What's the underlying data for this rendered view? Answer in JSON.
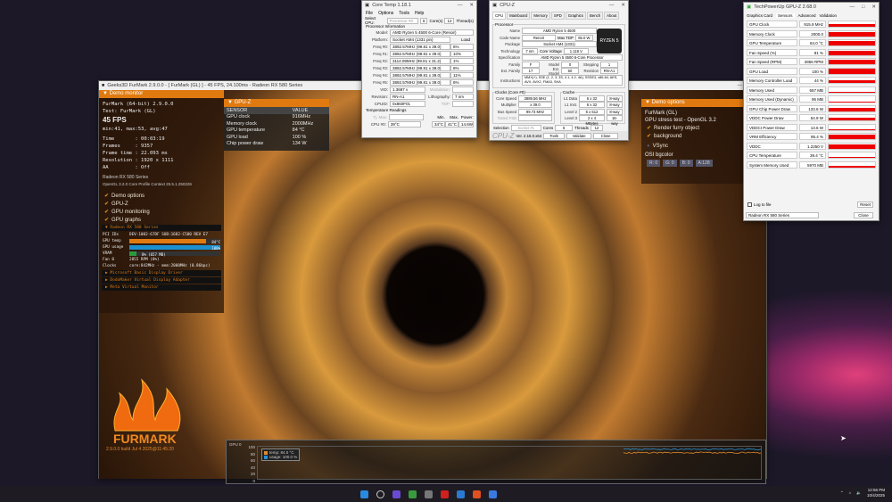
{
  "furmark": {
    "title": "Geeks3D FurMark 2.9.0.0 - [ FurMark (GL) ] - 45 FPS, 24.100ms - Radeon RX 580 Series",
    "demo_monitor": {
      "header": "Demo monitor",
      "name": "FurMark (64-bit) 2.9.0.0",
      "test": "Test: FurMark (GL)",
      "fps": "45 FPS",
      "stats": "min:41, max:53, avg:47",
      "lines": [
        "Time       : 00:03:19",
        "Frames     : 9357",
        "Frame time : 22.093 ms",
        "Resolution : 1920 x 1111",
        "AA         : Off"
      ],
      "gpu": "Radeon RX 580 Series",
      "opengl": "OpenGL 3.2.0 Core Profile Context 25.5.1.250226",
      "checks": [
        "Demo options",
        "GPU-Z",
        "GPU monitoring",
        "GPU graphs"
      ],
      "gpu_group": "Radeon RX 580 Series",
      "pci": "PCI IDs",
      "pci_val": "DEV:1002-67DF SUB:1682-C580 REV E7",
      "temp_label": "GPU temp",
      "temp_val": "84°C",
      "temp_pct": 84,
      "usage_label": "GPU usage",
      "usage_val": "100%",
      "usage_pct": 100,
      "vram_label": "VRAM",
      "vram_val": "8% (657 MB)",
      "vram_pct": 8,
      "fan_label": "Fan 0",
      "fan_val": "2855 RPM (0%)",
      "clocks_label": "Clocks",
      "clocks_val": "core:842MHz - mem:2000MHz (0.86bpc)",
      "adapters": [
        "Microsoft Basic Display Driver",
        "DodoMaker Virtual Display Adapter",
        "Meta Virtual Monitor"
      ]
    },
    "gpuz_panel": {
      "header": "GPU-Z",
      "cols": [
        "SENSOR",
        "VALUE"
      ],
      "rows": [
        [
          "GPU clock",
          "916MHz"
        ],
        [
          "Memory clock",
          "2000MHz"
        ],
        [
          "GPU temperature",
          "84 °C"
        ],
        [
          "GPU load",
          "100 %"
        ],
        [
          "Chip power draw",
          "134 W"
        ]
      ]
    },
    "demo_options": {
      "header": "Demo options",
      "name": "FurMark (GL)",
      "desc": "GPU stress test - OpenGL 3.2",
      "checks": [
        "Render furry object",
        "background"
      ],
      "vsync": "VSync",
      "osi_label": "OSI bgcolor",
      "osi": [
        "R: 0",
        "G: 0",
        "B: 0",
        "A:128"
      ]
    },
    "logo_version": "2.9.0.0 build Jul  4 2025@11:45:20",
    "graph": {
      "title": "GPU 0",
      "ticks": [
        "100",
        "80",
        "60",
        "40",
        "20",
        "0"
      ],
      "legend": [
        "temp: 84.0 °C",
        "usage: 100.0 %"
      ],
      "colors": [
        "#e08a30",
        "#2a90d0"
      ]
    }
  },
  "coretemp": {
    "title": "Core Temp 1.18.1",
    "menu": [
      "File",
      "Options",
      "Tools",
      "Help"
    ],
    "select_cpu": "Select CPU:",
    "cpu": "Processor #0",
    "cores": "6",
    "cores_l": "Core(s)",
    "threads": "12",
    "threads_l": "Thread(s)",
    "section": "Processor Information",
    "model_l": "Model:",
    "model": "AMD Ryzen 5 4500 6-Core (Renoir)",
    "platform_l": "Platform:",
    "platform": "Socket AM4 (1331 pin)",
    "load_l": "Load",
    "freqs": [
      [
        "Freq #0:",
        "3892.57MHz (99.81 x 39.0)",
        "6%"
      ],
      [
        "Freq #1:",
        "3892.57MHz (99.81 x 39.0)",
        "10%"
      ],
      [
        "Freq #2:",
        "3114.09MHz (99.81 x 31.2)",
        "1%"
      ],
      [
        "Freq #3:",
        "3892.57MHz (99.81 x 39.0)",
        "8%"
      ],
      [
        "Freq #4:",
        "3892.57MHz (99.81 x 39.0)",
        "11%"
      ],
      [
        "Freq #5:",
        "3892.57MHz (99.81 x 39.0)",
        "6%"
      ]
    ],
    "vid_l": "VID:",
    "vid": "1.3687 v",
    "modulation_l": "Modulation:",
    "revision_l": "Revision:",
    "revision": "RN-A1",
    "litho_l": "Lithography:",
    "litho": "7 nm",
    "cpuid_l": "CPUID:",
    "cpuid": "0x860F01",
    "tdp_l": "TDP:",
    "temp_section": "Temperature Readings",
    "tjmax_l": "Tj. Max:",
    "min_l": "Min.",
    "max_l": "Max.",
    "power_l": "Power:",
    "cpu0_l": "CPU #0:",
    "cpu0": "39°C",
    "min": "34°C",
    "max": "41°C",
    "power": "14.6W"
  },
  "cpuz": {
    "title": "CPU-Z",
    "tabs": [
      "CPU",
      "Mainboard",
      "Memory",
      "SPD",
      "Graphics",
      "Bench",
      "About"
    ],
    "processor": "Processor",
    "name_l": "Name",
    "name": "AMD Ryzen 5 4500",
    "code_l": "Code Name",
    "code": "Renoir",
    "tdp_l": "Max TDP",
    "tdp": "65.0 W",
    "pkg_l": "Package",
    "pkg": "Socket AM4 (1331)",
    "tech_l": "Technology",
    "tech": "7 nm",
    "volt_l": "Core Voltage",
    "volt": "1.118 V",
    "spec_l": "Specification",
    "spec": "AMD Ryzen 5 4500 6-Core Processor",
    "family_l": "Family",
    "family": "F",
    "model_l": "Model",
    "model": "0",
    "step_l": "Stepping",
    "step": "1",
    "extfam_l": "Ext. Family",
    "extfam": "17",
    "extmod_l": "Ext. Model",
    "extmod": "60",
    "rev_l": "Revision",
    "rev": "RN-A1",
    "instr_l": "Instructions",
    "instr": "MMX(+), SSE (1, 2, 3, 3S, 4.1, 4.2, 4A), SSSE3, x86-64, AES, AVX, AVX2, FMA3, SHA",
    "clocks": "Clocks (Core #0)",
    "speed_l": "Core Speed",
    "speed": "3889.56 MHz",
    "mult_l": "Multiplier",
    "mult": "x 39.0",
    "bus_l": "Bus Speed",
    "bus": "99.73 MHz",
    "fsb_l": "Rated FSB",
    "cache": "Cache",
    "caches": [
      [
        "L1 Data",
        "6 x 32 KBytes",
        "8-way"
      ],
      [
        "L1 Inst.",
        "6 x 32 KBytes",
        "8-way"
      ],
      [
        "Level 2",
        "6 x 512 KBytes",
        "8-way"
      ],
      [
        "Level 3",
        "2 x 4 MBytes",
        "16-way"
      ]
    ],
    "sel_l": "Selection",
    "sel": "Socket #1",
    "cores_l": "Cores",
    "cores": "6",
    "threads_l": "Threads",
    "threads": "12",
    "brand": "CPU-Z",
    "ver": "Ver. 2.16.0.x64",
    "tools": "Tools",
    "validate": "Validate",
    "close": "Close",
    "logo": "RYZEN 5"
  },
  "gpuz": {
    "title": "TechPowerUp GPU-Z 2.68.0",
    "tabs": [
      "Graphics Card",
      "Sensors",
      "Advanced",
      "Validation"
    ],
    "sensors": [
      [
        "GPU Clock",
        "915.9 MHz",
        0.5
      ],
      [
        "Memory Clock",
        "2000.0 MHz",
        0.8
      ],
      [
        "GPU Temperature",
        "84.0 °C",
        0.9
      ],
      [
        "Fan Speed (%)",
        "81 %",
        0.85
      ],
      [
        "Fan Speed (RPM)",
        "2856 RPM",
        0.85
      ],
      [
        "GPU Load",
        "100 %",
        0.9
      ],
      [
        "Memory Controller Load",
        "44 %",
        0.5
      ],
      [
        "Memory Used (Dedicated)",
        "657 MB",
        0.1
      ],
      [
        "Memory Used (Dynamic)",
        "95 MB",
        0.05
      ],
      [
        "GPU Chip Power Draw",
        "133.6 W",
        0.7
      ],
      [
        "VDDC Power Draw",
        "54.9 W",
        0.6
      ],
      [
        "VDDCI Power Draw",
        "13.6 W",
        0.1
      ],
      [
        "VRM Efficiency",
        "95.4 %",
        0.9
      ],
      [
        "VDDC",
        "1.2250 V",
        0.8
      ],
      [
        "CPU Temperature",
        "39.4 °C",
        0.15
      ],
      [
        "System Memory Used",
        "5970 MB",
        0.3
      ]
    ],
    "log": "Log to file",
    "reset": "Reset",
    "device": "Radeon RX 580 Series",
    "close": "Close"
  },
  "taskbar": {
    "time": "12:56 PM",
    "date": "10/4/2025",
    "apps": [
      "start",
      "search",
      "app-purple",
      "app-green",
      "app-gpuz",
      "aida64",
      "app-blue",
      "furmark",
      "app-window"
    ]
  }
}
